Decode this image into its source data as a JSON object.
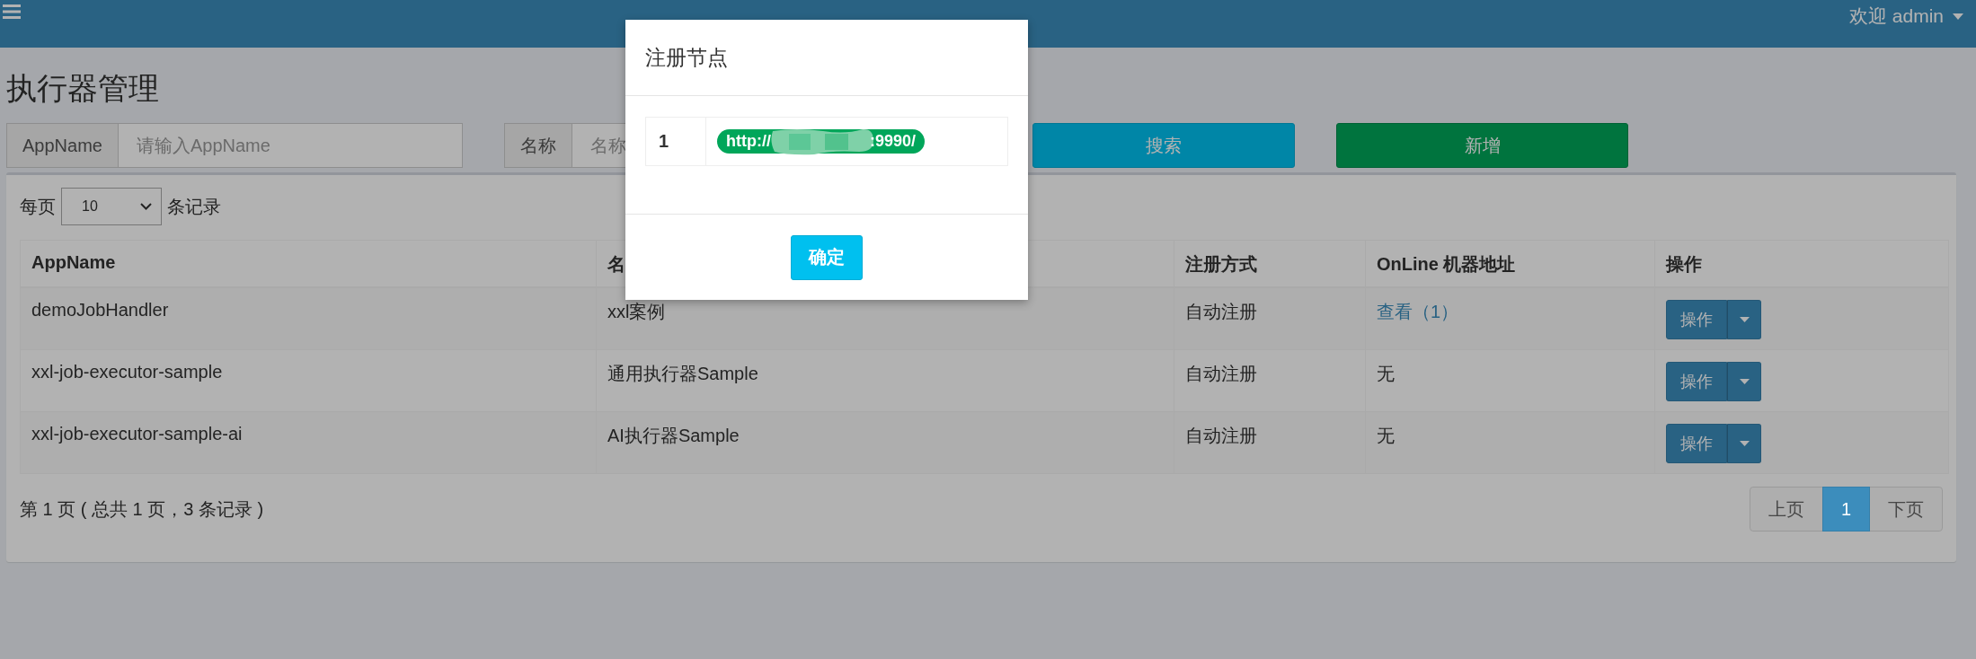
{
  "header": {
    "user_menu": "欢迎 admin"
  },
  "page_title": "执行器管理",
  "filters": [
    {
      "label": "AppName",
      "placeholder": "请输入AppName"
    },
    {
      "label": "名称",
      "placeholder": "名称"
    }
  ],
  "buttons": [
    {
      "label": "搜索",
      "kind": "search"
    },
    {
      "label": "新增",
      "kind": "add"
    }
  ],
  "page_size": {
    "prefix": "每页",
    "value": "10",
    "suffix": "条记录"
  },
  "table": {
    "columns": [
      "AppName",
      "名",
      "注册方式",
      "OnLine 机器地址",
      "操作"
    ],
    "rows": [
      {
        "app_name": "demoJobHandler",
        "name": "xxl案例",
        "registration": "自动注册",
        "online": {
          "kind": "link",
          "text": "查看（1）"
        },
        "action": "操作"
      },
      {
        "app_name": "xxl-job-executor-sample",
        "name": "通用执行器Sample",
        "registration": "自动注册",
        "online": {
          "kind": "text",
          "text": "无"
        },
        "action": "操作"
      },
      {
        "app_name": "xxl-job-executor-sample-ai",
        "name": "AI执行器Sample",
        "registration": "自动注册",
        "online": {
          "kind": "text",
          "text": "无"
        },
        "action": "操作"
      }
    ]
  },
  "summary": "第 1 页 ( 总共 1 页，3 条记录 )",
  "pagination": [
    {
      "label": "上页",
      "selected": false
    },
    {
      "label": "1",
      "selected": true
    },
    {
      "label": "下页",
      "selected": false
    }
  ],
  "modal": {
    "title": "注册节点",
    "nodes": [
      {
        "index": "1",
        "address_start": "http://",
        "address_end": ":9990/"
      }
    ],
    "confirm": "确定"
  }
}
